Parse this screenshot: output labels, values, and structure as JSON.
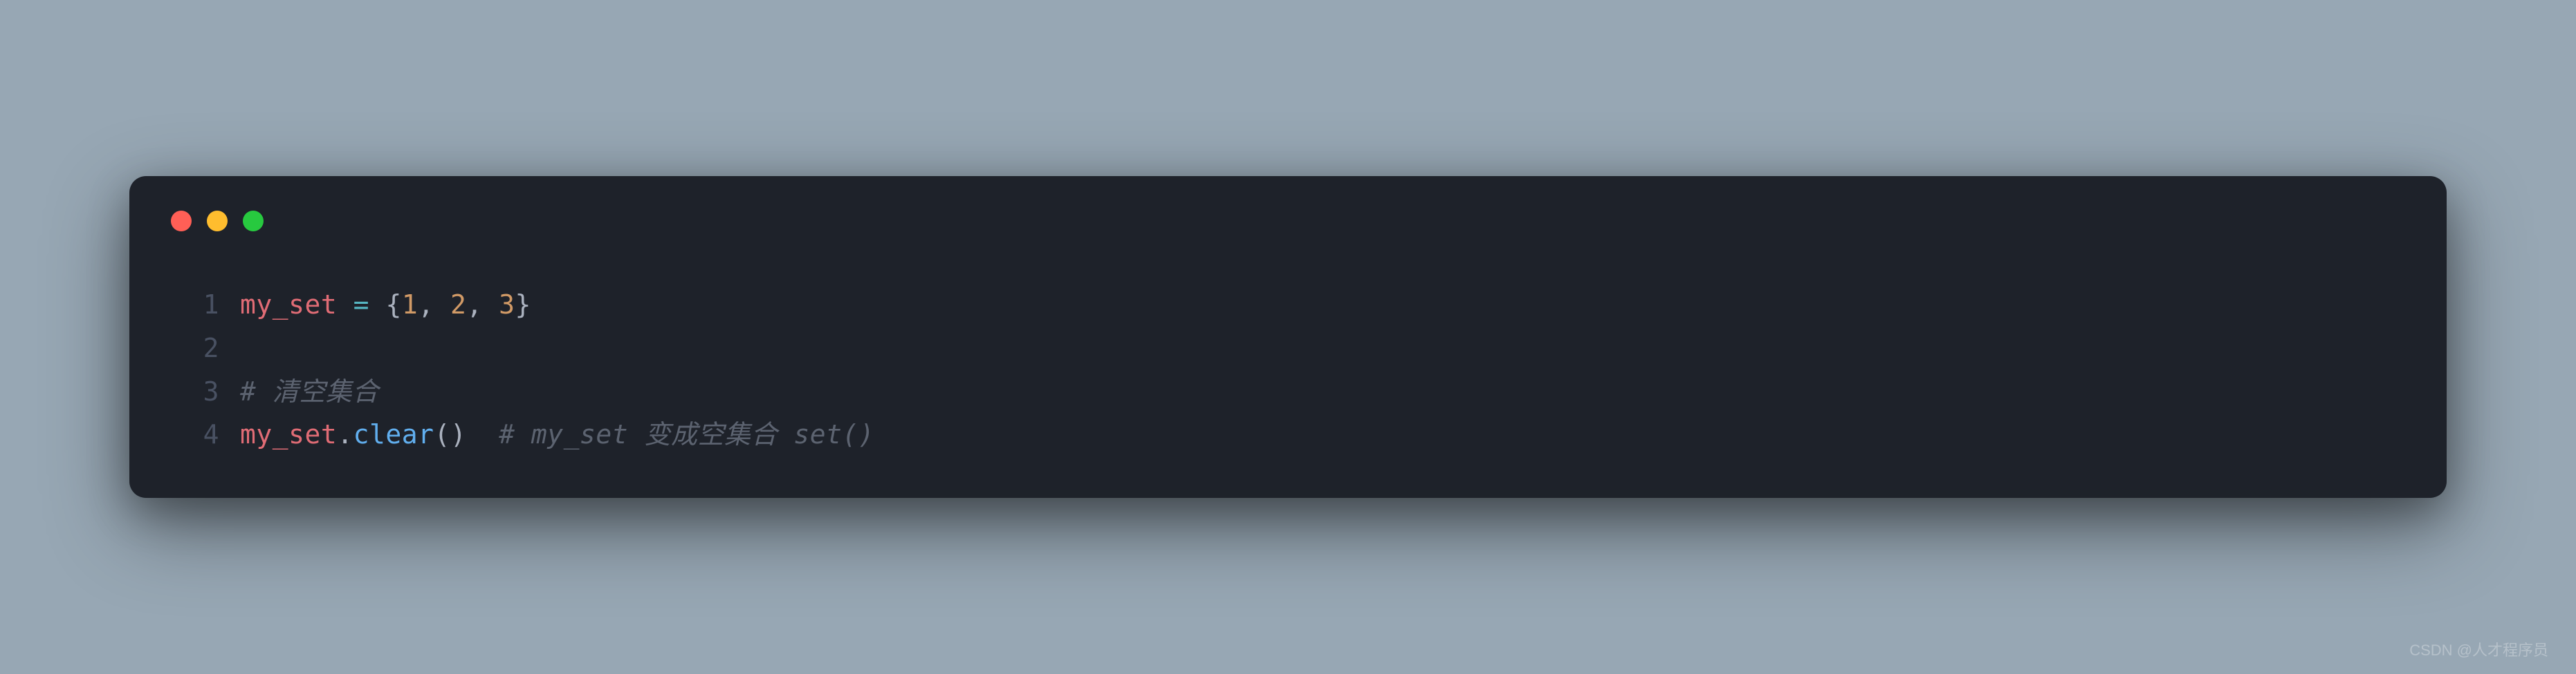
{
  "window": {
    "controls": [
      "close",
      "minimize",
      "maximize"
    ]
  },
  "code": {
    "language": "python",
    "lines": [
      {
        "num": "1",
        "tokens": [
          {
            "text": "my_set",
            "cls": "tok-variable"
          },
          {
            "text": " ",
            "cls": "tok-default"
          },
          {
            "text": "=",
            "cls": "tok-operator"
          },
          {
            "text": " ",
            "cls": "tok-default"
          },
          {
            "text": "{",
            "cls": "tok-punc"
          },
          {
            "text": "1",
            "cls": "tok-number"
          },
          {
            "text": ", ",
            "cls": "tok-punc"
          },
          {
            "text": "2",
            "cls": "tok-number"
          },
          {
            "text": ", ",
            "cls": "tok-punc"
          },
          {
            "text": "3",
            "cls": "tok-number"
          },
          {
            "text": "}",
            "cls": "tok-punc"
          }
        ]
      },
      {
        "num": "2",
        "tokens": []
      },
      {
        "num": "3",
        "tokens": [
          {
            "text": "# 清空集合",
            "cls": "tok-comment"
          }
        ]
      },
      {
        "num": "4",
        "tokens": [
          {
            "text": "my_set",
            "cls": "tok-variable"
          },
          {
            "text": ".",
            "cls": "tok-punc"
          },
          {
            "text": "clear",
            "cls": "tok-method"
          },
          {
            "text": "()",
            "cls": "tok-punc"
          },
          {
            "text": "  ",
            "cls": "tok-default"
          },
          {
            "text": "# my_set 变成空集合 set()",
            "cls": "tok-comment"
          }
        ]
      }
    ]
  },
  "watermark": "CSDN @人才程序员"
}
